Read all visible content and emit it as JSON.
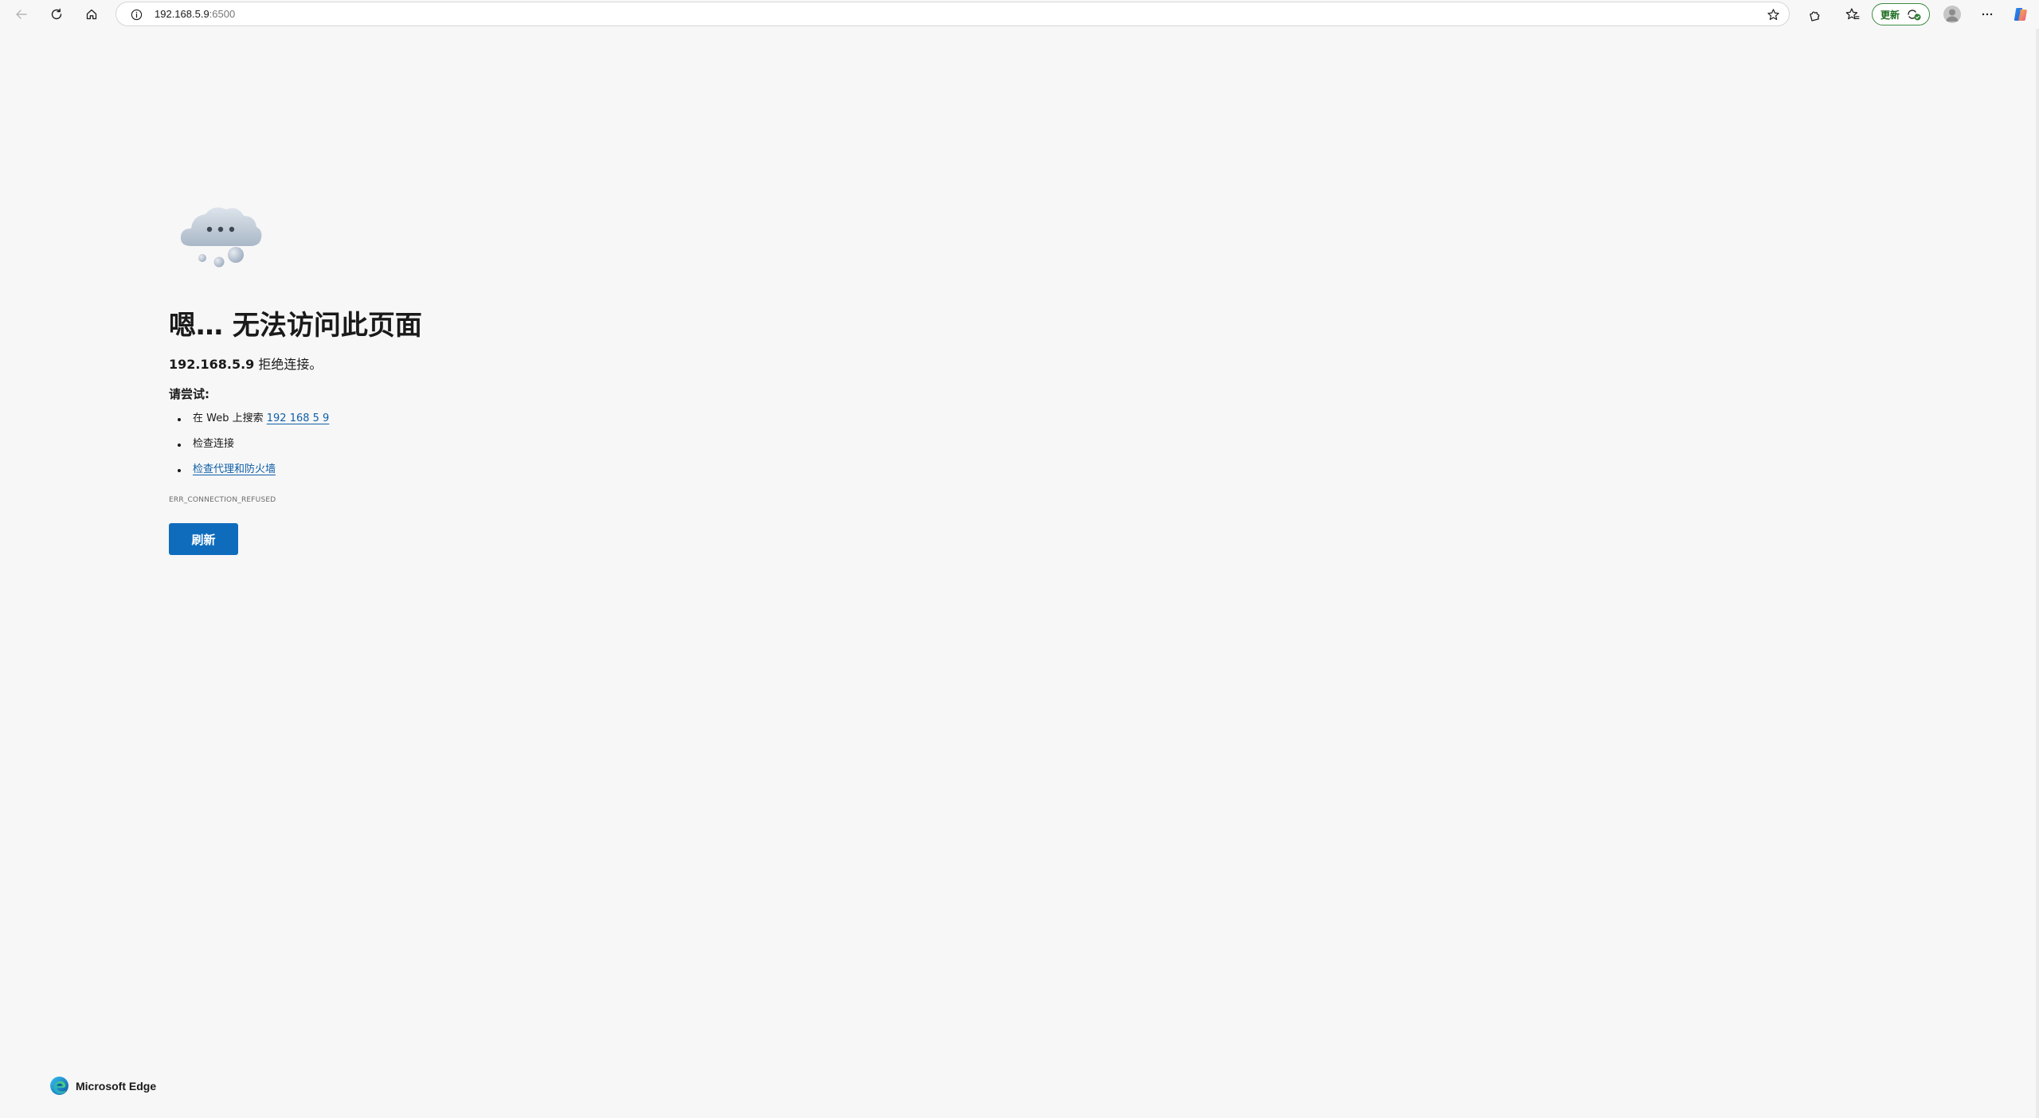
{
  "toolbar": {
    "back_icon": "arrow-left-icon",
    "reload_icon": "reload-icon",
    "home_icon": "home-icon",
    "address": {
      "host": "192.168.5.9",
      "port": ":6500"
    },
    "favorite_icon": "star-outline-icon",
    "extensions_icon": "puzzle-icon",
    "favorites_icon": "favorites-star-icon",
    "update_label": "更新",
    "more_icon": "ellipsis-icon",
    "copilot_icon": "copilot-icon"
  },
  "error": {
    "title": "嗯… 无法访问此页面",
    "host": "192.168.5.9",
    "desc_suffix": " 拒绝连接。",
    "try_label": "请尝试:",
    "suggestion_search_prefix": "在 Web 上搜索 ",
    "suggestion_search_link": "192 168 5 9",
    "suggestion_check_connection": "检查连接",
    "suggestion_proxy_link": "检查代理和防火墙",
    "code": "ERR_CONNECTION_REFUSED",
    "refresh_label": "刷新"
  },
  "footer": {
    "brand": "Microsoft Edge"
  },
  "colors": {
    "accent": "#0f6cbd",
    "link": "#0f5fa8",
    "update_green": "#3b8a3e",
    "background": "#f7f7f7"
  }
}
